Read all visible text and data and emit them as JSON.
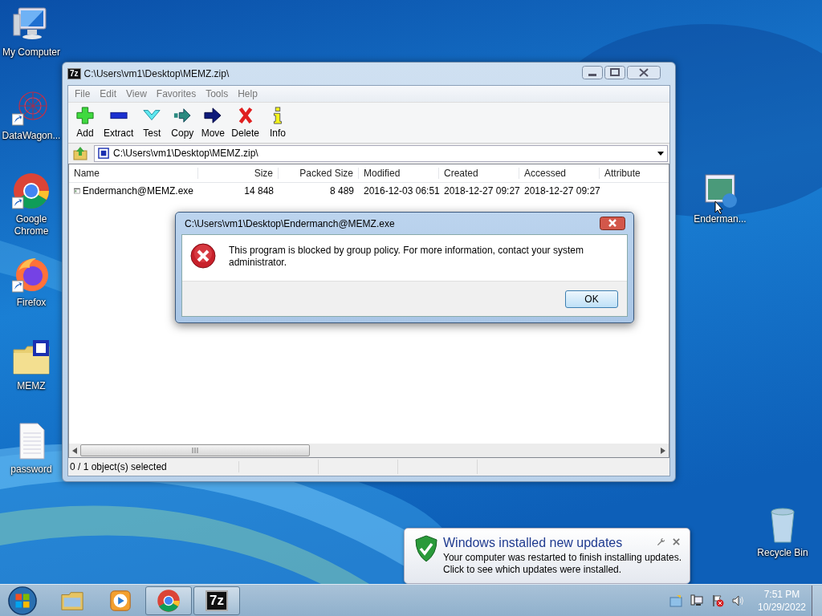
{
  "desktop_icons": [
    {
      "label": "My Computer",
      "kind": "computer",
      "shortcut": false
    },
    {
      "label": "DataWagon...",
      "kind": "mesh",
      "shortcut": true
    },
    {
      "label": "Google Chrome",
      "kind": "chrome",
      "shortcut": true
    },
    {
      "label": "Firefox",
      "kind": "firefox",
      "shortcut": true
    },
    {
      "label": "MEMZ",
      "kind": "zipfolder",
      "shortcut": false
    },
    {
      "label": "password",
      "kind": "textfile",
      "shortcut": false
    },
    {
      "label": "Enderman...",
      "kind": "program",
      "shortcut": false
    },
    {
      "label": "Recycle Bin",
      "kind": "bin",
      "shortcut": false
    }
  ],
  "window": {
    "icon_text": "7z",
    "title": "C:\\Users\\vm1\\Desktop\\MEMZ.zip\\",
    "menu": [
      "File",
      "Edit",
      "View",
      "Favorites",
      "Tools",
      "Help"
    ],
    "toolbar": [
      {
        "label": "Add",
        "kind": "add"
      },
      {
        "label": "Extract",
        "kind": "extract"
      },
      {
        "label": "Test",
        "kind": "test"
      },
      {
        "label": "Copy",
        "kind": "copy"
      },
      {
        "label": "Move",
        "kind": "move"
      },
      {
        "label": "Delete",
        "kind": "delete"
      },
      {
        "label": "Info",
        "kind": "info"
      }
    ],
    "address": "C:\\Users\\vm1\\Desktop\\MEMZ.zip\\",
    "columns": [
      "Name",
      "Size",
      "Packed Size",
      "Modified",
      "Created",
      "Accessed",
      "Attribute"
    ],
    "rows": [
      {
        "cells": [
          "Endermanch@MEMZ.exe",
          "14 848",
          "8 489",
          "2016-12-03 06:51",
          "2018-12-27 09:27",
          "2018-12-27 09:27"
        ],
        "selected": false
      }
    ],
    "status_bar": [
      "0 / 1 object(s) selected"
    ]
  },
  "dialog": {
    "title": "C:\\Users\\vm1\\Desktop\\Endermanch@MEMZ.exe",
    "message": "This program is blocked by group policy. For more information, contact your system administrator.",
    "buttons": [
      "OK"
    ]
  },
  "notification": {
    "title": "Windows installed new updates",
    "body": "Your computer was restarted to finish installing updates. Click to see which updates were installed."
  },
  "taskbar": {
    "items": [
      {
        "kind": "explorer",
        "active": false
      },
      {
        "kind": "media",
        "active": false
      },
      {
        "kind": "chrome",
        "active": true
      },
      {
        "kind": "sevenzip",
        "label": "7z",
        "active": true
      }
    ],
    "time": "7:51 PM",
    "date": "10/29/2022"
  }
}
